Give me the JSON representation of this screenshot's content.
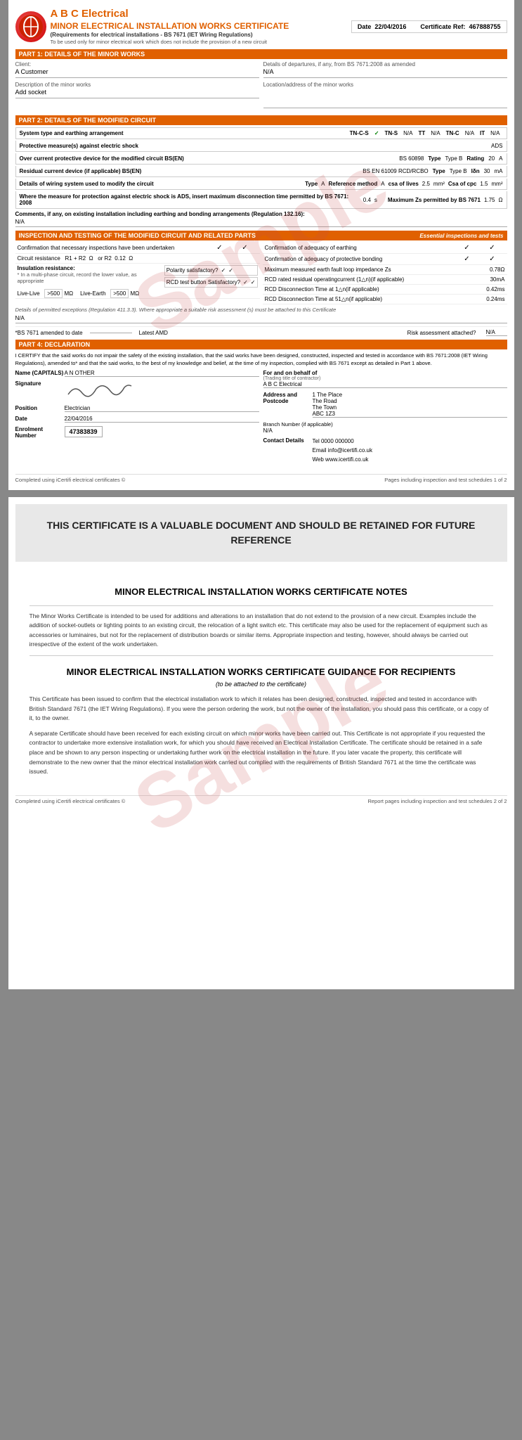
{
  "page1": {
    "header": {
      "date_label": "Date",
      "date_value": "22/04/2016",
      "cert_ref_label": "Certificate Ref:",
      "cert_ref_value": "467888755"
    },
    "company": {
      "name": "A B C Electrical",
      "cert_title": "MINOR ELECTRICAL INSTALLATION WORKS CERTIFICATE",
      "requirements": "(Requirements for electrical installations - BS 7671 (IET Wiring Regulations)",
      "usage_note": "To be used only for minor electrical work which does not include the provision of a new circuit"
    },
    "part1": {
      "title": "PART 1: DETAILS OF THE MINOR WORKS",
      "client_label": "Client:",
      "client_value": "A Customer",
      "description_label": "Description of the minor works",
      "description_value": "Add socket",
      "departures_label": "Details of departures, if any, from BS 7671:2008 as amended",
      "departures_value": "N/A",
      "location_label": "Location/address of the minor works",
      "location_value": ""
    },
    "part2": {
      "title": "PART 2: DETAILS OF THE MODIFIED CIRCUIT",
      "earthing_label": "System type and earthing arrangement",
      "earthing_tncs": "TN-C-S",
      "earthing_tncs_check": "✓",
      "earthing_tns": "TN-S",
      "earthing_tns_val": "N/A",
      "earthing_tt": "TT",
      "earthing_tt_val": "N/A",
      "earthing_tnc": "TN-C",
      "earthing_tnc_val": "N/A",
      "earthing_it": "IT",
      "earthing_it_val": "N/A",
      "protective_label": "Protective measure(s) against electric shock",
      "protective_value": "ADS",
      "overcurrent_label": "Over current protective device for the modified circuit BS(EN)",
      "overcurrent_bs": "BS 60898",
      "overcurrent_type_label": "Type",
      "overcurrent_type_val": "Type B",
      "overcurrent_rating_label": "Rating",
      "overcurrent_rating_val": "20",
      "overcurrent_unit": "A",
      "rcd_label": "Residual current device (if applicable) BS(EN)",
      "rcd_bs": "BS EN 61009 RCD/RCBO",
      "rcd_type_label": "Type",
      "rcd_type_val": "Type B",
      "rcd_ion_label": "Iδn",
      "rcd_ion_val": "30",
      "rcd_unit": "mA",
      "wiring_label": "Details of wiring system used to modify the circuit",
      "wiring_type_label": "Type",
      "wiring_type_val": "A",
      "wiring_ref_label": "Reference method",
      "wiring_ref_val": "A",
      "wiring_csa_label": "csa of lives",
      "wiring_csa_val": "2.5",
      "wiring_mm2": "mm²",
      "wiring_csa_cpc_label": "Csa of cpc",
      "wiring_csa_cpc_val": "1.5",
      "wiring_mm2_2": "mm²",
      "protection_label": "Where the measure for protection against electric shock is ADS, insert maximum disconnection time permitted by BS 7671: 2008",
      "protection_val": "0.4",
      "protection_s": "s",
      "max_zs_label": "Maximum Zs permitted by BS 7671",
      "max_zs_val": "1.75",
      "max_zs_unit": "Ω",
      "comments_label": "Comments, if any, on existing installation including earthing and bonding arrangements (Regulation 132.16):",
      "comments_value": "N/A"
    },
    "part3": {
      "title": "INSPECTION AND TESTING OF THE MODIFIED CIRCUIT AND RELATED PARTS",
      "essential_label": "Essential inspections and tests",
      "confirm_inspect_label": "Confirmation that necessary inspections have been undertaken",
      "confirm_inspect_v1": "✓",
      "confirm_inspect_v2": "✓",
      "confirm_earthing_label": "Confirmation of adequacy of earthing",
      "confirm_earthing_v1": "✓",
      "confirm_earthing_v2": "✓",
      "circuit_resist_label": "Circuit resistance",
      "r1r2_label": "R1 + R2",
      "r1r2_unit": "Ω",
      "or_r2_label": "or R2",
      "or_r2_val": "0.12",
      "or_r2_unit": "Ω",
      "confirm_bonding_label": "Confirmation of adequacy of protective bonding",
      "confirm_bonding_v1": "✓",
      "confirm_bonding_v2": "✓",
      "insulation_label": "Insulation resistance:",
      "insulation_sub": "* In a multi-phase circuit, record the lower value, as appropriate",
      "polarity_label": "Polarity satisfactory?",
      "polarity_v1": "✓",
      "polarity_v2": "✓",
      "max_zs_meas_label": "Maximum measured earth fault loop impedance Zs",
      "max_zs_meas_val": "0.78",
      "max_zs_meas_unit": "Ω",
      "rcd_test_label": "RCD test button Satisfactory?",
      "rcd_test_v1": "✓",
      "rcd_test_v2": "✓",
      "rcd_rated_label": "RCD rated residual operatingcurrent (1△n)(if applicable)",
      "rcd_rated_val": "30",
      "rcd_rated_unit": "mA",
      "live_live_label": "Live-Live",
      "live_live_val": ">500",
      "live_live_unit": "MΩ",
      "rcd_disc_1_label": "RCD Disconnection Time at 1△n(if applicable)",
      "rcd_disc_1_val": "0.42",
      "rcd_disc_1_unit": "ms",
      "live_earth_label": "Live-Earth",
      "live_earth_val": ">500",
      "live_earth_unit": "MΩ",
      "rcd_disc_51_label": "RCD Disconnection Time at 51△n(if applicable)",
      "rcd_disc_51_val": "0.24",
      "rcd_disc_51_unit": "ms",
      "details_note": "Details of permitted exceptions (Regulation 411.3.3). Where appropriate a suitable risk assessment (s) must be attached to this Certificate",
      "details_value": "N/A",
      "bs_amended_label": "*BS 7671 amended to date",
      "bs_amended_val": "",
      "latest_amd_label": "Latest AMD",
      "risk_label": "Risk assessment attached?",
      "risk_val": "N/A"
    },
    "part4": {
      "title": "PART 4: DECLARATION",
      "declaration_text": "I CERTIFY that the said works do not impair the safety of the existing installation, that the said works have been designed, constructed, inspected and tested in accordance with BS 7671:2008 (IET Wiring Regulations), amended to* and that the said works, to the best of my knowledge and belief, at the time of my inspection, complied with BS 7671 except as detailed in Part 1 above.",
      "name_label": "Name (CAPITALS)",
      "name_value": "A N OTHER",
      "behalf_label": "For and on behalf of",
      "behalf_sub": "(Trading title of contractor)",
      "behalf_value": "A B C Electrical",
      "signature_label": "Signature",
      "address_label": "Address and Postcode",
      "address_value": "1 The Place\nThe Road\nThe Town\nABC 1Z3",
      "position_label": "Position",
      "position_value": "Electrician",
      "branch_label": "Branch Number (if applicable)",
      "branch_value": "N/A",
      "date_label": "Date",
      "date_value": "22/04/2016",
      "tel_label": "Tel",
      "tel_value": "0000 000000",
      "email_label": "Email",
      "email_value": "info@icertifi.co.uk",
      "web_label": "Web",
      "web_value": "www.icertifi.co.uk",
      "contact_label": "Contact Details",
      "enrolment_label": "Enrolment Number",
      "enrolment_value": "47383839"
    },
    "footer": {
      "left": "Completed using iCertifi electrical certificates ©",
      "right": "Pages including inspection and test schedules 1 of 2"
    }
  },
  "page2": {
    "banner": {
      "text": "THIS CERTIFICATE IS A VALUABLE DOCUMENT AND SHOULD BE RETAINED FOR FUTURE REFERENCE"
    },
    "notes": {
      "title": "MINOR ELECTRICAL INSTALLATION WORKS CERTIFICATE NOTES",
      "body": "The Minor Works Certificate is intended to be used for additions and alterations to an installation that do not extend to the provision of a new circuit. Examples include the addition of socket-outlets or lighting points to an existing circuit, the relocation of a light switch etc. This certificate may also be used for the replacement of equipment such as accessories or luminaires, but not for the replacement of distribution boards or similar items. Appropriate inspection and testing, however, should always be carried out irrespective of the extent of the work undertaken."
    },
    "guidance": {
      "title": "MINOR ELECTRICAL INSTALLATION WORKS CERTIFICATE GUIDANCE FOR RECIPIENTS",
      "subtitle": "(to be attached to the certificate)",
      "para1": "This Certificate has been issued to confirm that the electrical installation work to which it relates has been designed, constructed, inspected and tested in accordance with British Standard 7671 (the IET Wiring Regulations). If you were the person ordering the work, but not the owner of the installation, you should pass this certificate, or a copy of it, to the owner.",
      "para2": "A separate Certificate should have been received for each existing circuit on which minor works have been carried out. This Certificate is not appropriate if you requested the contractor to undertake more extensive installation work, for which you should have received an Electrical Installation Certificate. The certificate should be retained in a safe place and be shown to any person inspecting or undertaking further work on the electrical installation in the future. If you later vacate the property, this certificate will demonstrate to the new owner that the minor electrical installation work carried out complied with the requirements of British Standard 7671 at the time the certificate was issued."
    },
    "footer": {
      "left": "Completed using iCertifi electrical certificates ©",
      "right": "Report pages including inspection and test schedules 2 of 2"
    }
  }
}
